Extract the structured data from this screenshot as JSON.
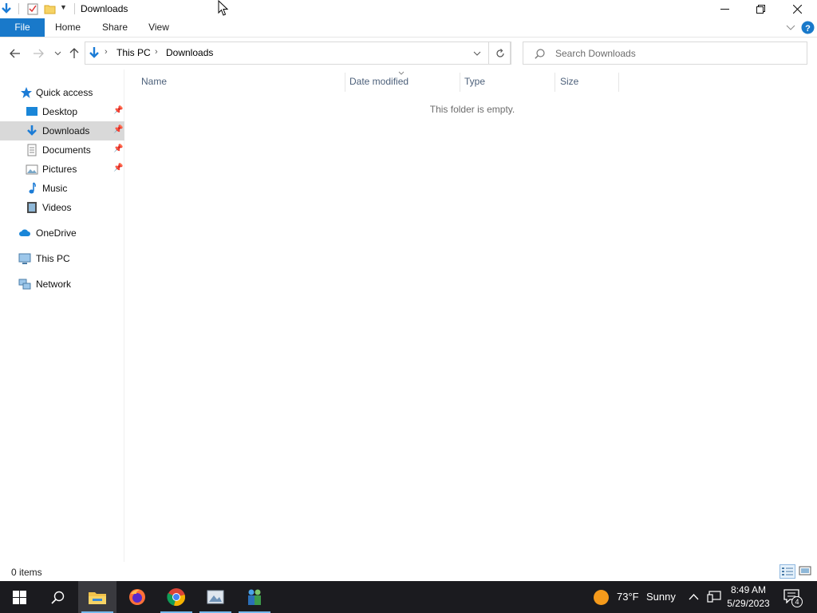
{
  "window": {
    "title": "Downloads",
    "controls": {
      "minimize": "minimize",
      "maximize": "restore",
      "close": "close"
    }
  },
  "ribbon": {
    "tabs": [
      {
        "label": "File",
        "active": true
      },
      {
        "label": "Home"
      },
      {
        "label": "Share"
      },
      {
        "label": "View"
      }
    ]
  },
  "address": {
    "breadcrumb": [
      "This PC",
      "Downloads"
    ]
  },
  "search": {
    "placeholder": "Search Downloads",
    "value": ""
  },
  "sidebar": {
    "quick_access": "Quick access",
    "items": [
      {
        "label": "Desktop",
        "pinned": true,
        "icon": "desktop-icon"
      },
      {
        "label": "Downloads",
        "pinned": true,
        "selected": true,
        "icon": "downloads-icon"
      },
      {
        "label": "Documents",
        "pinned": true,
        "icon": "documents-icon"
      },
      {
        "label": "Pictures",
        "pinned": true,
        "icon": "pictures-icon"
      },
      {
        "label": "Music",
        "icon": "music-icon"
      },
      {
        "label": "Videos",
        "icon": "videos-icon"
      }
    ],
    "onedrive": "OneDrive",
    "this_pc": "This PC",
    "network": "Network"
  },
  "content": {
    "columns": [
      "Name",
      "Date modified",
      "Type",
      "Size"
    ],
    "empty_message": "This folder is empty."
  },
  "status": {
    "item_count": "0 items"
  },
  "taskbar": {
    "weather_temp": "73°F",
    "weather_desc": "Sunny",
    "time": "8:49 AM",
    "date": "5/29/2023",
    "notification_count": "4"
  },
  "colors": {
    "accent": "#1979ca",
    "selected": "#d9d9d9",
    "taskbar": "#1b1b1f"
  }
}
